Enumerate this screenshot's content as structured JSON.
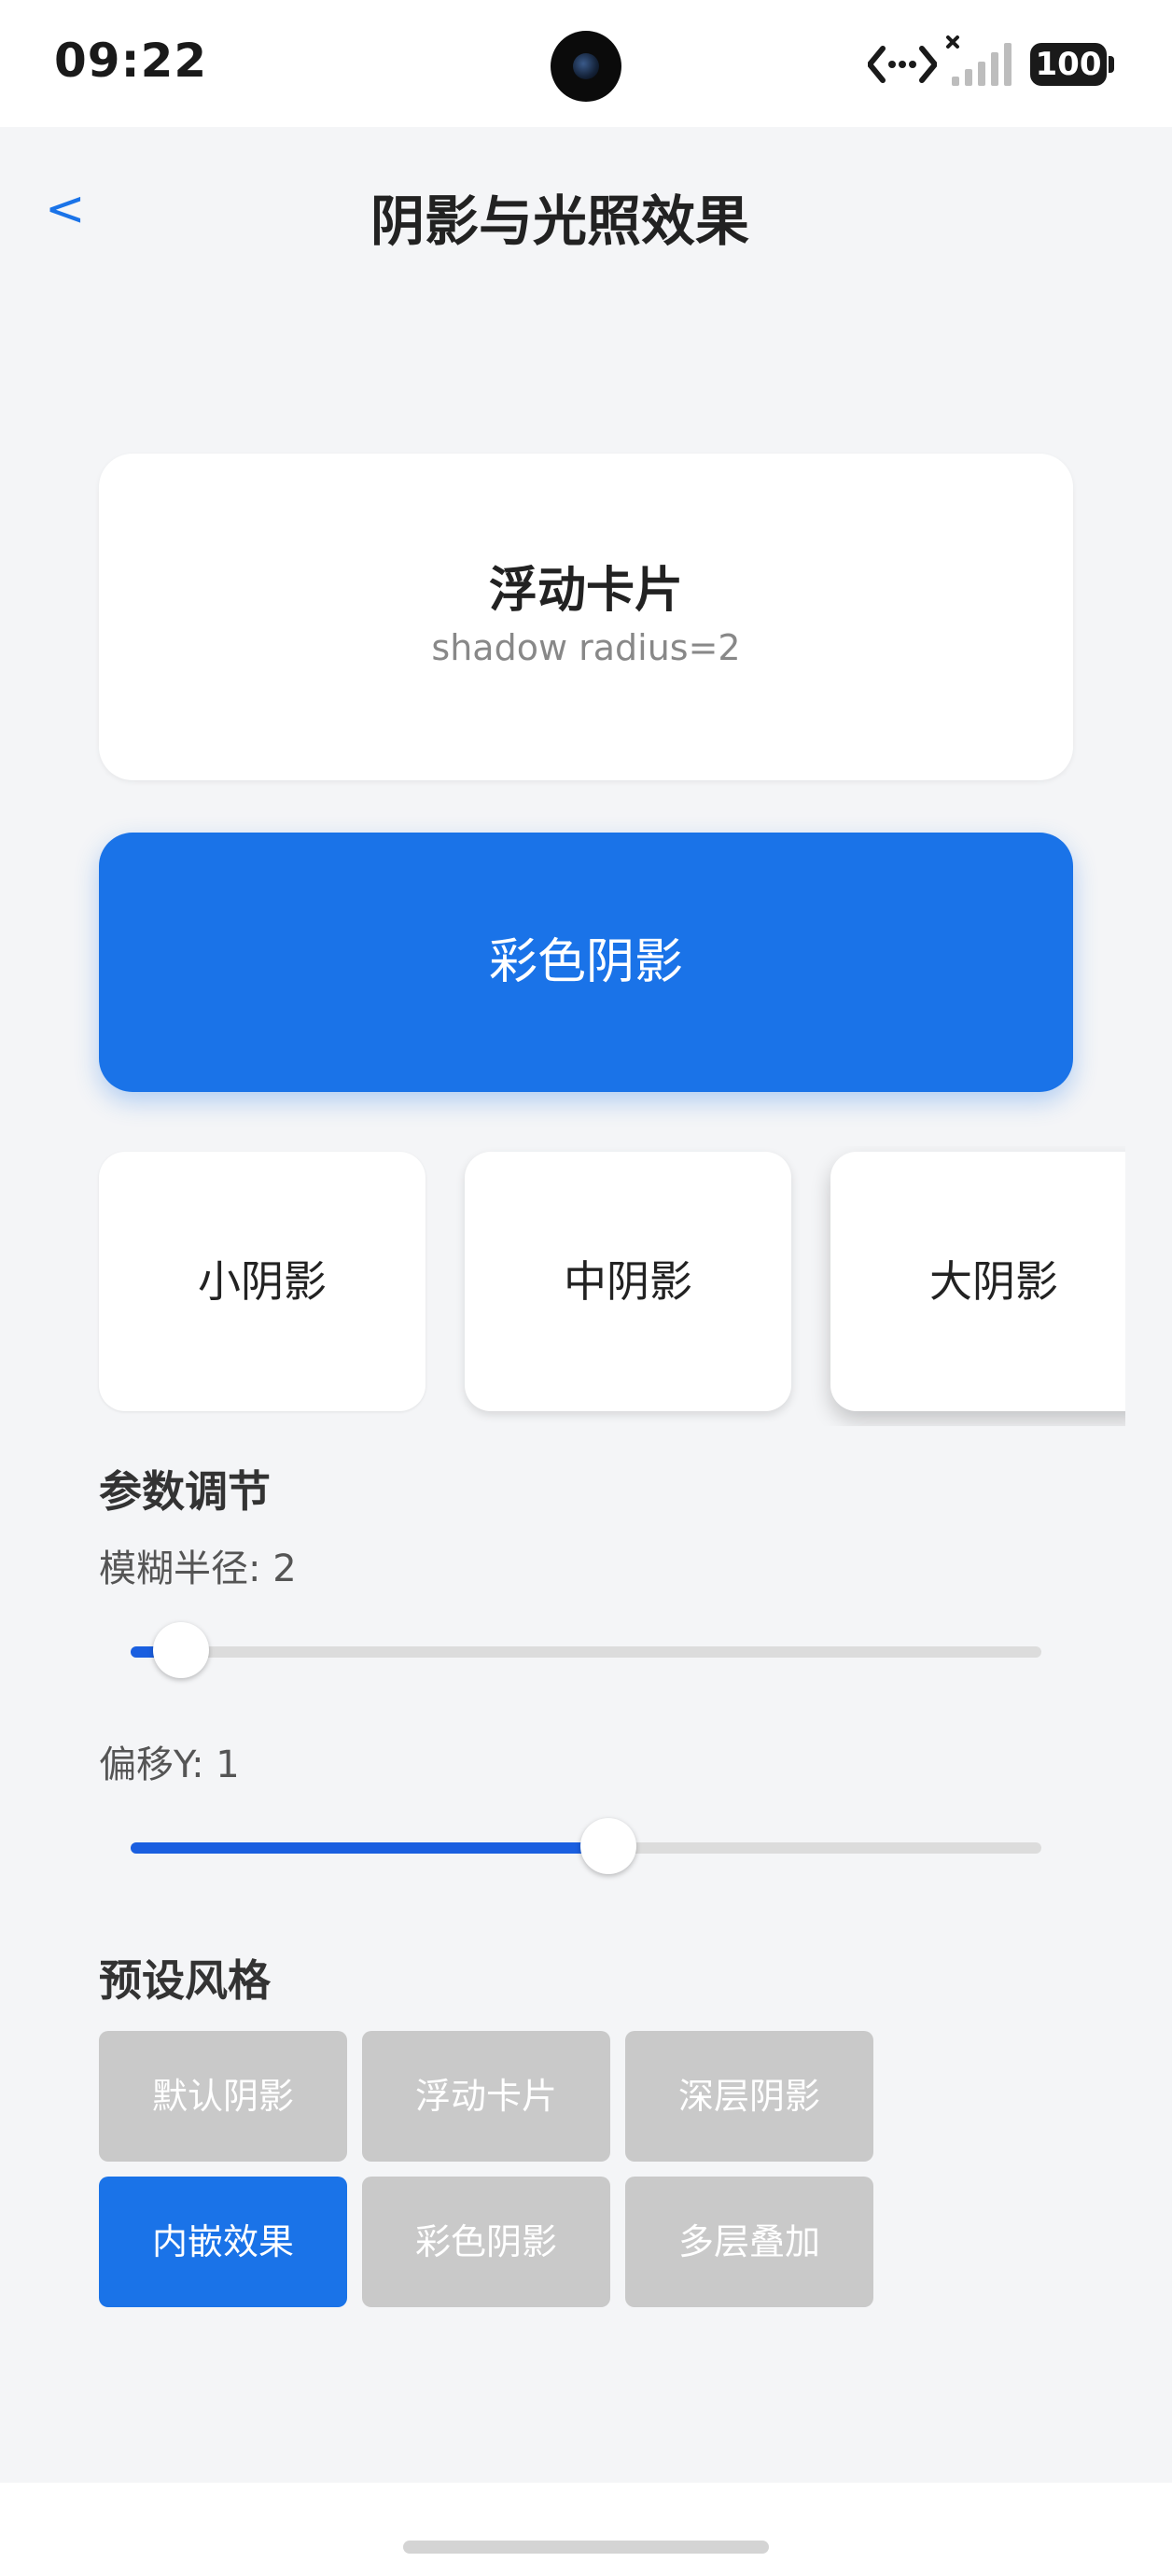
{
  "status_bar": {
    "time": "09:22",
    "battery": "100",
    "icons": [
      "camera-icon",
      "network-arrows-icon",
      "signal-icon",
      "battery-icon"
    ]
  },
  "header": {
    "back": "<",
    "title": "阴影与光照效果"
  },
  "float_card": {
    "title": "浮动卡片",
    "subtitle": "shadow radius=2"
  },
  "color_card": {
    "label": "彩色阴影",
    "color": "#1a73e8"
  },
  "shadow_cards": [
    {
      "label": "小阴影"
    },
    {
      "label": "中阴影"
    },
    {
      "label": "大阴影"
    }
  ],
  "params": {
    "title": "参数调节",
    "blur_label": "模糊半径: 2",
    "blur_fraction": 0.055,
    "offset_label": "偏移Y: 1",
    "offset_fraction": 0.525
  },
  "presets": {
    "title": "预设风格",
    "items": [
      "默认阴影",
      "浮动卡片",
      "深层阴影",
      "内嵌效果",
      "彩色阴影",
      "多层叠加"
    ],
    "active": "内嵌效果",
    "accent": "#1a73e8",
    "inactive": "#c9c9c9"
  }
}
